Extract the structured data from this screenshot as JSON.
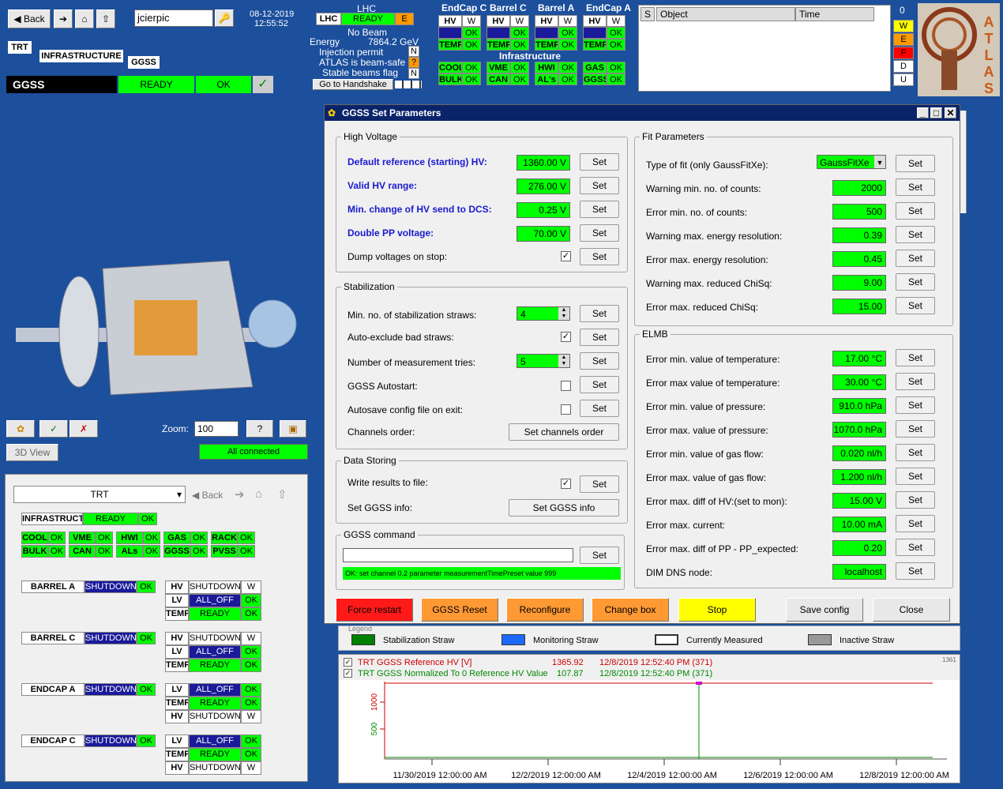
{
  "nav": {
    "back": "Back",
    "user": "jcierpic",
    "date": "08-12-2019",
    "time": "12:55:52"
  },
  "breadcrumb": {
    "trt": "TRT",
    "infra": "INFRASTRUCTURE",
    "ggss": "GGSS"
  },
  "ggss_bar": {
    "name": "GGSS",
    "state": "READY",
    "status": "OK"
  },
  "lhc": {
    "title": "LHC",
    "label": "LHC",
    "state": "READY",
    "flag": "E",
    "beam": "No Beam",
    "energy_label": "Energy",
    "energy": "7864.2 GeV",
    "inj": "Injection permit",
    "inj_v": "N",
    "safe": "ATLAS is beam-safe",
    "safe_v": "?",
    "stable": "Stable beams flag",
    "stable_v": "N",
    "handshake": "Go to Handshake"
  },
  "parts": [
    {
      "name": "EndCap C",
      "r1": [
        "HV",
        "W"
      ],
      "r2": [
        "LV",
        "OK"
      ],
      "r3": [
        "TEMP",
        "OK"
      ]
    },
    {
      "name": "Barrel C",
      "r1": [
        "HV",
        "W"
      ],
      "r2": [
        "LV",
        "OK"
      ],
      "r3": [
        "TEMP",
        "OK"
      ]
    },
    {
      "name": "Barrel A",
      "r1": [
        "HV",
        "W"
      ],
      "r2": [
        "LV",
        "OK"
      ],
      "r3": [
        "TEMP",
        "OK"
      ]
    },
    {
      "name": "EndCap A",
      "r1": [
        "HV",
        "W"
      ],
      "r2": [
        "LV",
        "OK"
      ],
      "r3": [
        "TEMP",
        "OK"
      ]
    }
  ],
  "infra_title": "Infrastructure",
  "infra_cells": [
    [
      "COOL",
      "OK"
    ],
    [
      "BULK",
      "OK"
    ],
    [
      "VME",
      "OK"
    ],
    [
      "CAN",
      "OK"
    ],
    [
      "HWI",
      "OK"
    ],
    [
      "AL's",
      "OK"
    ],
    [
      "GAS",
      "OK"
    ],
    [
      "GGSS",
      "OK"
    ]
  ],
  "alarm": {
    "s": "S",
    "object": "Object",
    "time": "Time",
    "count": "0",
    "w": "W",
    "e": "E",
    "f": "F",
    "d": "D",
    "u": "U"
  },
  "logo": "ATLAS",
  "view": {
    "zoom_label": "Zoom:",
    "zoom": "100",
    "view3d": "3D View",
    "connected": "All connected"
  },
  "tree": {
    "select": "TRT",
    "back": "Back",
    "infra": "INFRASTRUCT",
    "infra_state": "READY",
    "infra_status": "OK",
    "cells": [
      [
        "COOL",
        "OK"
      ],
      [
        "VME",
        "OK"
      ],
      [
        "HWI",
        "OK"
      ],
      [
        "GAS",
        "OK"
      ],
      [
        "RACK",
        "OK"
      ],
      [
        "BULK",
        "OK"
      ],
      [
        "CAN",
        "OK"
      ],
      [
        "ALs",
        "OK"
      ],
      [
        "GGSS",
        "OK"
      ],
      [
        "PVSS",
        "OK"
      ]
    ],
    "parts": [
      {
        "name": "BARREL A",
        "state": "SHUTDOWN",
        "status": "OK",
        "rows": [
          [
            "HV",
            "SHUTDOWN",
            "W"
          ],
          [
            "LV",
            "ALL_OFF",
            "OK"
          ],
          [
            "TEMP",
            "READY",
            "OK"
          ]
        ]
      },
      {
        "name": "BARREL C",
        "state": "SHUTDOWN",
        "status": "OK",
        "rows": [
          [
            "HV",
            "SHUTDOWN",
            "W"
          ],
          [
            "LV",
            "ALL_OFF",
            "OK"
          ],
          [
            "TEMP",
            "READY",
            "OK"
          ]
        ]
      },
      {
        "name": "ENDCAP A",
        "state": "SHUTDOWN",
        "status": "OK",
        "rows": [
          [
            "LV",
            "ALL_OFF",
            "OK"
          ],
          [
            "TEMP",
            "READY",
            "OK"
          ],
          [
            "HV",
            "SHUTDOWN",
            "W"
          ]
        ]
      },
      {
        "name": "ENDCAP C",
        "state": "SHUTDOWN",
        "status": "OK",
        "rows": [
          [
            "LV",
            "ALL_OFF",
            "OK"
          ],
          [
            "TEMP",
            "READY",
            "OK"
          ],
          [
            "HV",
            "SHUTDOWN",
            "W"
          ]
        ]
      }
    ]
  },
  "dialog": {
    "title": "GGSS Set Parameters",
    "set": "Set",
    "hv": {
      "title": "High Voltage",
      "rows": [
        {
          "label": "Default reference (starting) HV:",
          "value": "1360.00 V"
        },
        {
          "label": "Valid HV range:",
          "value": "276.00 V"
        },
        {
          "label": "Min. change of HV send to DCS:",
          "value": "0.25 V"
        },
        {
          "label": "Double PP voltage:",
          "value": "70.00 V"
        }
      ],
      "dump": "Dump voltages on stop:"
    },
    "stab": {
      "title": "Stabilization",
      "min_straws": "Min. no. of stabilization straws:",
      "min_straws_v": "4",
      "auto_excl": "Auto-exclude bad straws:",
      "tries": "Number of measurement tries:",
      "tries_v": "5",
      "autostart": "GGSS Autostart:",
      "autosave": "Autosave config file on exit:",
      "order": "Channels order:",
      "order_btn": "Set channels order"
    },
    "store": {
      "title": "Data Storing",
      "write": "Write results to file:",
      "info": "Set GGSS info:",
      "info_btn": "Set GGSS info"
    },
    "cmd": {
      "title": "GGSS command",
      "status": "OK: set channel 0.2 parameter measurementTimePreset value 999"
    },
    "fit": {
      "title": "Fit Parameters",
      "type_label": "Type of fit (only GaussFitXe):",
      "type": "GaussFitXe",
      "rows": [
        {
          "label": "Warning min. no. of counts:",
          "value": "2000"
        },
        {
          "label": "Error min. no. of counts:",
          "value": "500"
        },
        {
          "label": "Warning max. energy resolution:",
          "value": "0.39"
        },
        {
          "label": "Error max. energy resolution:",
          "value": "0.45"
        },
        {
          "label": "Warning max. reduced ChiSq:",
          "value": "9.00"
        },
        {
          "label": "Error max. reduced ChiSq:",
          "value": "15.00"
        }
      ]
    },
    "elmb": {
      "title": "ELMB",
      "rows": [
        {
          "label": "Error min. value of temperature:",
          "value": "17.00 °C"
        },
        {
          "label": "Error max value of temperature:",
          "value": "30.00 °C"
        },
        {
          "label": "Error min. value of pressure:",
          "value": "910.0 hPa"
        },
        {
          "label": "Error max. value of pressure:",
          "value": "1070.0 hPa"
        },
        {
          "label": "Error min. value of gas flow:",
          "value": "0.020 nl/h"
        },
        {
          "label": "Error max. value of gas flow:",
          "value": "1.200 nl/h"
        },
        {
          "label": "Error max. diff of HV:(set to mon):",
          "value": "15.00 V"
        },
        {
          "label": "Error max. current:",
          "value": "10.00 mA"
        },
        {
          "label": "Error max. diff of PP - PP_expected:",
          "value": "0.20"
        },
        {
          "label": "DIM DNS node:",
          "value": "localhost"
        }
      ]
    },
    "buttons": {
      "force": "Force restart",
      "reset": "GGSS Reset",
      "reconf": "Reconfigure",
      "change": "Change box",
      "stop": "Stop",
      "save": "Save config",
      "close": "Close"
    }
  },
  "legend": {
    "title": "Legend",
    "stab": "Stabilization Straw",
    "mon": "Monitoring Straw",
    "cur": "Currently Measured",
    "inact": "Inactive Straw"
  },
  "chart_data": {
    "type": "line",
    "series": [
      {
        "name": "TRT GGSS Reference HV [V]",
        "last": "1365.92",
        "time": "12/8/2019 12:52:40 PM (371)",
        "color": "#cc0000"
      },
      {
        "name": "TRT GGSS Normalized To 0 Reference HV Value",
        "last": "107.87",
        "time": "12/8/2019 12:52:40 PM (371)",
        "color": "#008800"
      }
    ],
    "x_ticks": [
      "11/30/2019 12:00:00 AM",
      "12/2/2019 12:00:00 AM",
      "12/4/2019 12:00:00 AM",
      "12/6/2019 12:00:00 AM",
      "12/8/2019 12:00:00 AM"
    ],
    "y_ticks": [
      "1000",
      "500"
    ],
    "corner": "1361"
  }
}
